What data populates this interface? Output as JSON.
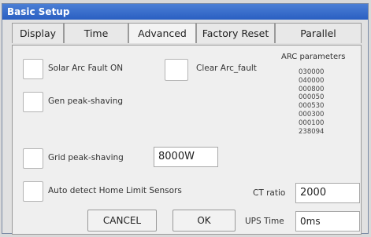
{
  "window": {
    "title": "Basic Setup"
  },
  "tabs": [
    {
      "label": "Display"
    },
    {
      "label": "Time"
    },
    {
      "label": "Advanced"
    },
    {
      "label": "Factory Reset"
    },
    {
      "label": "Parallel"
    }
  ],
  "settings": {
    "solar_arc_fault_label": "Solar Arc Fault ON",
    "clear_arc_fault_label": "Clear Arc_fault",
    "gen_peak_shaving_label": "Gen peak-shaving",
    "grid_peak_shaving_label": "Grid peak-shaving",
    "grid_peak_shaving_value": "8000W",
    "auto_detect_label": "Auto detect Home Limit Sensors",
    "ct_ratio_label": "CT ratio",
    "ct_ratio_value": "2000",
    "ups_time_label": "UPS Time",
    "ups_time_value": "0ms"
  },
  "arc_parameters": {
    "title": "ARC parameters",
    "values": [
      "030000",
      "040000",
      "000800",
      "000050",
      "000530",
      "000300",
      "000100",
      "238094"
    ]
  },
  "buttons": {
    "cancel": "CANCEL",
    "ok": "OK"
  }
}
